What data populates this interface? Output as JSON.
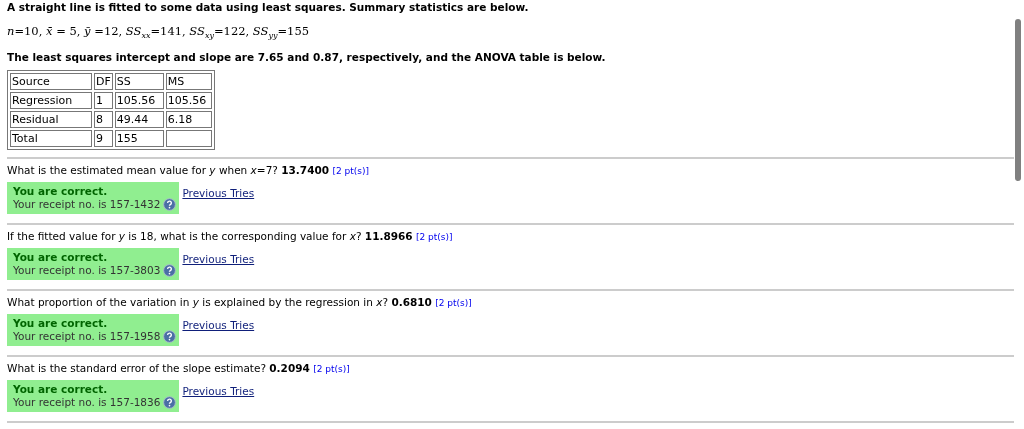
{
  "intro": {
    "heading": "A straight line is fitted to some data using least squares. Summary statistics are below.",
    "stats": "*n*=10, *x̄* = 5, *ȳ* =12, *SS*$_{xx}$=141, *SS*$_{xy}$=122, *SS*$_{yy}$=155",
    "sentence": "The least squares intercept and slope are 7.65 and 0.87, respectively, and the ANOVA table is below."
  },
  "anova_table": {
    "columns": [
      "Source",
      "DF",
      "SS",
      "MS"
    ],
    "rows": [
      [
        "Regression",
        "1",
        "105.56",
        "105.56"
      ],
      [
        "Residual",
        "8",
        "49.44",
        "6.18"
      ],
      [
        "Total",
        "9",
        "155",
        ""
      ]
    ]
  },
  "questions": [
    {
      "text": "What is the estimated mean value for *y* when *x*=7?",
      "answer": "13.7400",
      "points": "[2 pt(s)]",
      "feedback": {
        "kind": "correct",
        "title": "You are correct.",
        "receipt": "Your receipt no. is 157-1432"
      },
      "link": "Previous Tries"
    },
    {
      "text": "If the fitted value for *y* is 18, what is the corresponding value for *x*?",
      "answer": "11.8966",
      "points": "[2 pt(s)]",
      "feedback": {
        "kind": "correct",
        "title": "You are correct.",
        "receipt": "Your receipt no. is 157-3803"
      },
      "link": "Previous Tries"
    },
    {
      "text": "What proportion of the variation in *y* is explained by the regression in *x*?",
      "answer": "0.6810",
      "points": "[2 pt(s)]",
      "feedback": {
        "kind": "correct",
        "title": "You are correct.",
        "receipt": "Your receipt no. is 157-1958"
      },
      "link": "Previous Tries"
    },
    {
      "text": "What is the standard error of the slope estimate?",
      "answer": "0.2094",
      "points": "[2 pt(s)]",
      "feedback": {
        "kind": "correct",
        "title": "You are correct.",
        "receipt": "Your receipt no. is 157-1836"
      },
      "link": "Previous Tries"
    }
  ]
}
